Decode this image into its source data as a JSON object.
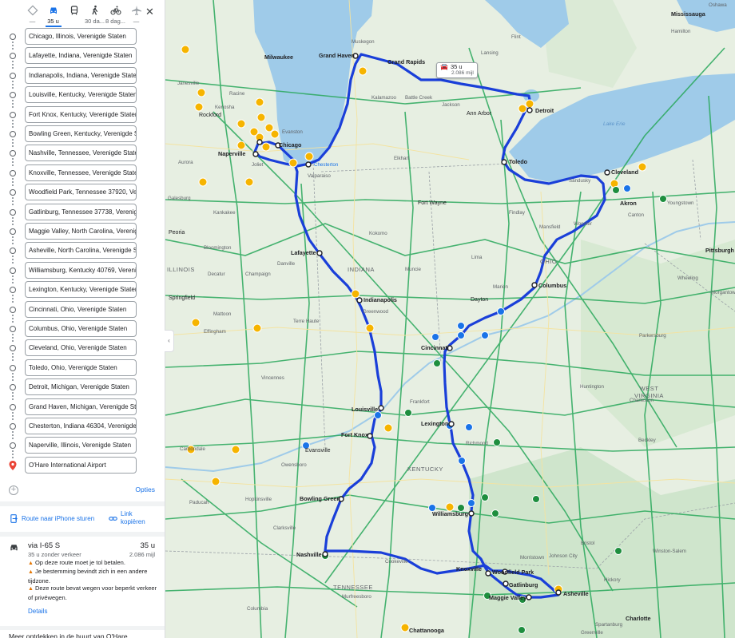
{
  "modes": [
    {
      "icon": "best-route-icon",
      "label": "—"
    },
    {
      "icon": "car-icon",
      "label": "35 u"
    },
    {
      "icon": "transit-icon",
      "label": ""
    },
    {
      "icon": "walk-icon",
      "label": "30 da..."
    },
    {
      "icon": "bike-icon",
      "label": "8 dag..."
    },
    {
      "icon": "flight-icon",
      "label": "—"
    }
  ],
  "close_label": "✕",
  "stops": [
    "Chicago, Illinois, Verenigde Staten",
    "Lafayette, Indiana, Verenigde Staten",
    "Indianapolis, Indiana, Verenigde Staten",
    "Louisville, Kentucky, Verenigde Staten",
    "Fort Knox, Kentucky, Verenigde Staten",
    "Bowling Green, Kentucky, Verenigde Staten",
    "Nashville, Tennessee, Verenigde Staten",
    "Knoxville, Tennessee, Verenigde Staten",
    "Woodfield Park, Tennessee 37920, Verenigde Staten",
    "Gatlinburg, Tennessee 37738, Verenigde Staten",
    "Maggie Valley, North Carolina, Verenigde Staten",
    "Asheville, North Carolina, Verenigde Staten",
    "Williamsburg, Kentucky 40769, Verenigde Staten",
    "Lexington, Kentucky, Verenigde Staten",
    "Cincinnati, Ohio, Verenigde Staten",
    "Columbus, Ohio, Verenigde Staten",
    "Cleveland, Ohio, Verenigde Staten",
    "Toledo, Ohio, Verenigde Staten",
    "Detroit, Michigan, Verenigde Staten",
    "Grand Haven, Michigan, Verenigde Staten",
    "Chesterton, Indiana 46304, Verenigde Staten",
    "Naperville, Illinois, Verenigde Staten",
    "O'Hare International Airport"
  ],
  "options_label": "Opties",
  "send_phone_label": "Route naar iPhone sturen",
  "copy_link_label_1": "Link",
  "copy_link_label_2": "kopiëren",
  "route": {
    "via": "via I-65 S",
    "time": "35 u",
    "sub": "35 u zonder verkeer",
    "distance": "2.086 mijl",
    "warnings": [
      "Op deze route moet je tol betalen.",
      "Je bestemming bevindt zich in een andere tijdzone.",
      "Deze route bevat wegen voor beperkt verkeer of privéwegen."
    ],
    "details_label": "Details"
  },
  "explore_label": "Meer ontdekken in de buurt van O'Hare",
  "map": {
    "badge_time": "35 u",
    "badge_distance": "2.086 mijl",
    "states": [
      "INDIANA",
      "OHIO",
      "KENTUCKY",
      "TENNESSEE",
      "WEST\nVIRGINIA",
      "ILLINOIS"
    ],
    "cities_major": [
      "Chicago",
      "Milwaukee",
      "Grand Haven",
      "Grand Rapids",
      "Detroit",
      "Toledo",
      "Cleveland",
      "Akron",
      "Columbus",
      "Indianapolis",
      "Lafayette",
      "Louisville",
      "Cincinnati",
      "Lexington",
      "Fort Knox",
      "Bowling Green",
      "Nashville",
      "Knoxville",
      "Woodfield Park",
      "Gatlinburg",
      "Maggie Valley",
      "Asheville",
      "Williamsburg",
      "Naperville",
      "Pittsburgh",
      "Mississauga",
      "Charlotte",
      "Chattanooga",
      "Dayton",
      "Fort Wayne",
      "Ann Arbor",
      "Evansville",
      "Peoria",
      "Springfield"
    ],
    "cities_minor": [
      "Muskegon",
      "Kenosha",
      "Racine",
      "Janesville",
      "Rockford",
      "Evanston",
      "Joliet",
      "Aurora",
      "Champaign",
      "Bloomington",
      "Terre Haute",
      "Muncie",
      "Kokomo",
      "Elkhart",
      "Mansfield",
      "Wooster",
      "Youngstown",
      "Canton",
      "Wheeling",
      "Morgantown",
      "Parkersburg",
      "Huntington",
      "Charleston",
      "Beckley",
      "Lima",
      "Marion",
      "Findlay",
      "Sandusky",
      "Lake Erie",
      "Lansing",
      "Kalamazoo",
      "Battle Creek",
      "Jackson",
      "Flint",
      "Oshawa",
      "Hamilton",
      "Owensboro",
      "Paducah",
      "Frankfort",
      "Richmond",
      "Bristol",
      "Johnson City",
      "Morristown",
      "Greenville",
      "Spartanburg",
      "Hickory",
      "Winston-Salem",
      "Columbia",
      "Murfreesboro",
      "Cookeville",
      "Clarksville",
      "Hopkinsville",
      "Greenwood",
      "Carbondale",
      "Vincennes",
      "Danville",
      "Decatur",
      "Mattoon",
      "Effingham",
      "Galesburg",
      "Kankakee",
      "Valparaiso",
      "Chesterton"
    ]
  },
  "colors": {
    "accent": "#1a73e8",
    "route": "#1a3fd9",
    "road_green": "#29a85b",
    "water": "#9fcbe9",
    "land": "#e8f0e4"
  }
}
